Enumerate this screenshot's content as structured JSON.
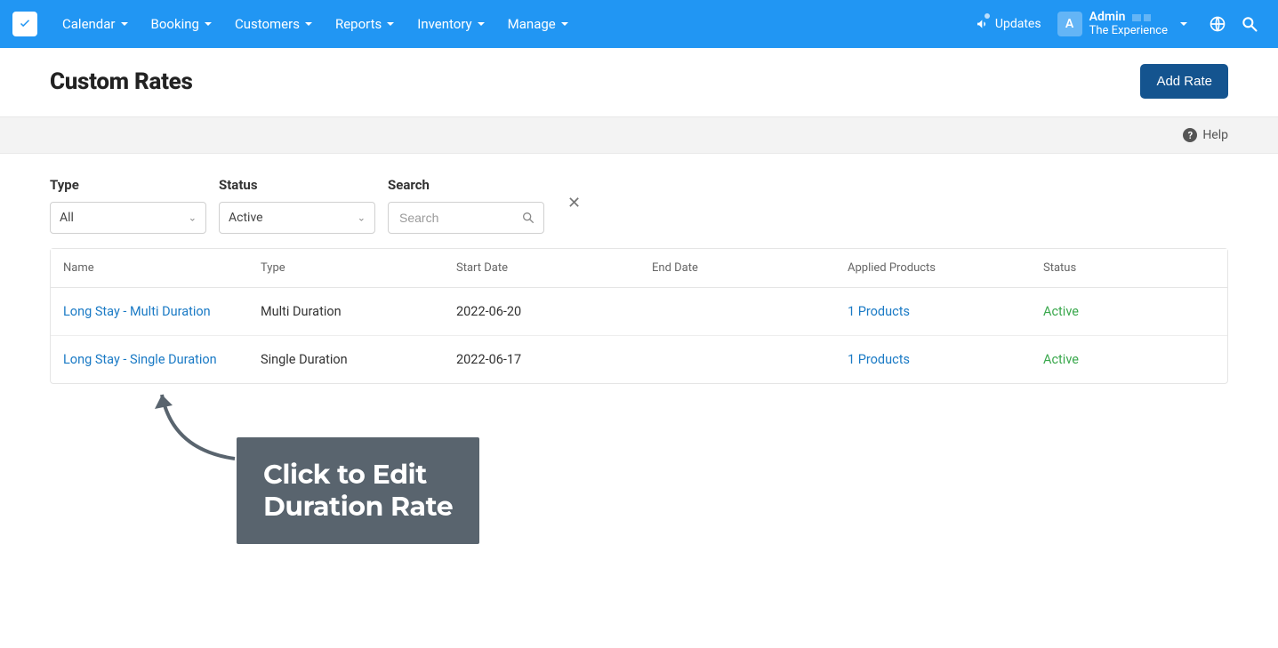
{
  "nav": {
    "items": [
      "Calendar",
      "Booking",
      "Customers",
      "Reports",
      "Inventory",
      "Manage"
    ],
    "updates_label": "Updates",
    "user_initial": "A",
    "user_name": "Admin",
    "user_sub": "The Experience"
  },
  "page": {
    "title": "Custom Rates",
    "add_button": "Add Rate",
    "help_label": "Help"
  },
  "filters": {
    "type_label": "Type",
    "type_value": "All",
    "status_label": "Status",
    "status_value": "Active",
    "search_label": "Search",
    "search_placeholder": "Search"
  },
  "table": {
    "headers": {
      "name": "Name",
      "type": "Type",
      "start": "Start Date",
      "end": "End Date",
      "products": "Applied Products",
      "status": "Status"
    },
    "rows": [
      {
        "name": "Long Stay - Multi Duration",
        "type": "Multi Duration",
        "start": "2022-06-20",
        "end": "",
        "products": "1 Products",
        "status": "Active"
      },
      {
        "name": "Long Stay - Single Duration",
        "type": "Single Duration",
        "start": "2022-06-17",
        "end": "",
        "products": "1 Products",
        "status": "Active"
      }
    ]
  },
  "callout": {
    "line1": "Click to Edit",
    "line2": "Duration Rate"
  }
}
